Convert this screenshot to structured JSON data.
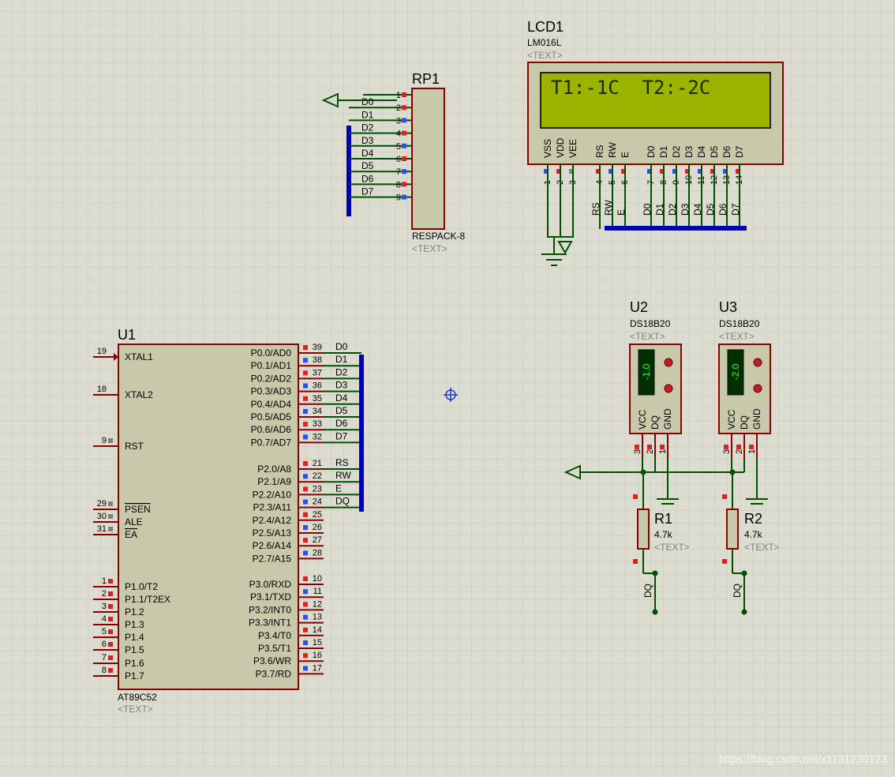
{
  "colors": {
    "background": "#dcdcd0",
    "grid_minor": "#c8c8b8",
    "grid_major": "#b4b4a4",
    "wire": "#005000",
    "bus": "#0000b4",
    "body_border": "#8b0000",
    "body_fill": "#c8c8aa",
    "pin_red": "#e02020",
    "pin_blue": "#3050e0",
    "pin_gray": "#808080",
    "lcd_screen": "#9cb400"
  },
  "text_placeholder": "<TEXT>",
  "rp1": {
    "ref": "RP1",
    "value": "RESPACK-8",
    "pins": [
      {
        "num": "1",
        "net": ""
      },
      {
        "num": "2",
        "net": "D0"
      },
      {
        "num": "3",
        "net": "D1"
      },
      {
        "num": "4",
        "net": "D2"
      },
      {
        "num": "5",
        "net": "D3"
      },
      {
        "num": "6",
        "net": "D4"
      },
      {
        "num": "7",
        "net": "D5"
      },
      {
        "num": "8",
        "net": "D6"
      },
      {
        "num": "9",
        "net": "D7"
      }
    ]
  },
  "lcd1": {
    "ref": "LCD1",
    "value": "LM016L",
    "display_text": "T1:-1C  T2:-2C",
    "pins": [
      {
        "num": "1",
        "name": "VSS",
        "net": ""
      },
      {
        "num": "2",
        "name": "VDD",
        "net": ""
      },
      {
        "num": "3",
        "name": "VEE",
        "net": ""
      },
      {
        "num": "4",
        "name": "RS",
        "net": "RS"
      },
      {
        "num": "5",
        "name": "RW",
        "net": "RW"
      },
      {
        "num": "6",
        "name": "E",
        "net": "E"
      },
      {
        "num": "7",
        "name": "D0",
        "net": "D0"
      },
      {
        "num": "8",
        "name": "D1",
        "net": "D1"
      },
      {
        "num": "9",
        "name": "D2",
        "net": "D2"
      },
      {
        "num": "10",
        "name": "D3",
        "net": "D3"
      },
      {
        "num": "11",
        "name": "D4",
        "net": "D4"
      },
      {
        "num": "12",
        "name": "D5",
        "net": "D5"
      },
      {
        "num": "13",
        "name": "D6",
        "net": "D6"
      },
      {
        "num": "14",
        "name": "D7",
        "net": "D7"
      }
    ]
  },
  "u1": {
    "ref": "U1",
    "value": "AT89C52",
    "left_pins": [
      {
        "num": "19",
        "name": "XTAL1"
      },
      {
        "num": "18",
        "name": "XTAL2"
      },
      {
        "num": "9",
        "name": "RST"
      },
      {
        "num": "29",
        "name": "PSEN"
      },
      {
        "num": "30",
        "name": "ALE"
      },
      {
        "num": "31",
        "name": "EA"
      },
      {
        "num": "1",
        "name": "P1.0/T2"
      },
      {
        "num": "2",
        "name": "P1.1/T2EX"
      },
      {
        "num": "3",
        "name": "P1.2"
      },
      {
        "num": "4",
        "name": "P1.3"
      },
      {
        "num": "5",
        "name": "P1.4"
      },
      {
        "num": "6",
        "name": "P1.5"
      },
      {
        "num": "7",
        "name": "P1.6"
      },
      {
        "num": "8",
        "name": "P1.7"
      }
    ],
    "right_pins": [
      {
        "num": "39",
        "name": "P0.0/AD0",
        "net": "D0"
      },
      {
        "num": "38",
        "name": "P0.1/AD1",
        "net": "D1"
      },
      {
        "num": "37",
        "name": "P0.2/AD2",
        "net": "D2"
      },
      {
        "num": "36",
        "name": "P0.3/AD3",
        "net": "D3"
      },
      {
        "num": "35",
        "name": "P0.4/AD4",
        "net": "D4"
      },
      {
        "num": "34",
        "name": "P0.5/AD5",
        "net": "D5"
      },
      {
        "num": "33",
        "name": "P0.6/AD6",
        "net": "D6"
      },
      {
        "num": "32",
        "name": "P0.7/AD7",
        "net": "D7"
      },
      {
        "num": "21",
        "name": "P2.0/A8",
        "net": "RS"
      },
      {
        "num": "22",
        "name": "P2.1/A9",
        "net": "RW"
      },
      {
        "num": "23",
        "name": "P2.2/A10",
        "net": "E"
      },
      {
        "num": "24",
        "name": "P2.3/A11",
        "net": "DQ"
      },
      {
        "num": "25",
        "name": "P2.4/A12",
        "net": ""
      },
      {
        "num": "26",
        "name": "P2.5/A13",
        "net": ""
      },
      {
        "num": "27",
        "name": "P2.6/A14",
        "net": ""
      },
      {
        "num": "28",
        "name": "P2.7/A15",
        "net": ""
      },
      {
        "num": "10",
        "name": "P3.0/RXD",
        "net": ""
      },
      {
        "num": "11",
        "name": "P3.1/TXD",
        "net": ""
      },
      {
        "num": "12",
        "name": "P3.2/INT0",
        "net": ""
      },
      {
        "num": "13",
        "name": "P3.3/INT1",
        "net": ""
      },
      {
        "num": "14",
        "name": "P3.4/T0",
        "net": ""
      },
      {
        "num": "15",
        "name": "P3.5/T1",
        "net": ""
      },
      {
        "num": "16",
        "name": "P3.6/WR",
        "net": ""
      },
      {
        "num": "17",
        "name": "P3.7/RD",
        "net": ""
      }
    ]
  },
  "sensors": [
    {
      "ref": "U2",
      "value": "DS18B20",
      "reading": "-1.0",
      "pins": [
        {
          "num": "3",
          "name": "VCC"
        },
        {
          "num": "2",
          "name": "DQ"
        },
        {
          "num": "1",
          "name": "GND"
        }
      ]
    },
    {
      "ref": "U3",
      "value": "DS18B20",
      "reading": "-2.0",
      "pins": [
        {
          "num": "3",
          "name": "VCC"
        },
        {
          "num": "2",
          "name": "DQ"
        },
        {
          "num": "1",
          "name": "GND"
        }
      ]
    }
  ],
  "resistors": [
    {
      "ref": "R1",
      "value": "4.7k",
      "net": "DQ"
    },
    {
      "ref": "R2",
      "value": "4.7k",
      "net": "DQ"
    }
  ],
  "watermark": "https://blog.csdn.net/x1131230123"
}
